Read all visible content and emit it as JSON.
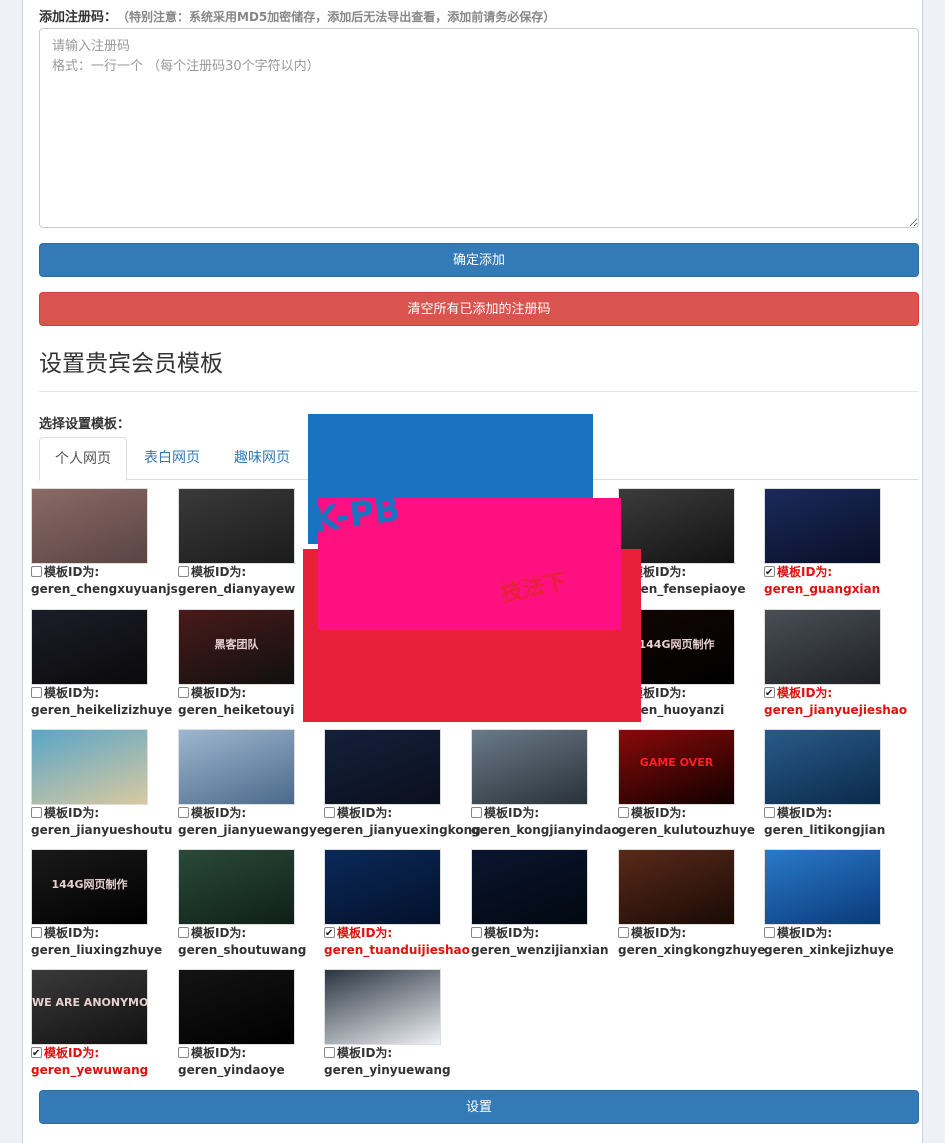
{
  "register": {
    "label": "添加注册码：",
    "note": "（特别注意：系统采用MD5加密储存，添加后无法导出查看，添加前请务必保存）",
    "placeholder": "请输入注册码\n格式：一行一个 （每个注册码30个字符以内）",
    "confirm_label": "确定添加",
    "clear_label": "清空所有已添加的注册码"
  },
  "vip": {
    "title": "设置贵宾会员模板",
    "choose_label": "选择设置模板：",
    "tabs": [
      "个人网页",
      "表白网页",
      "趣味网页"
    ],
    "id_prefix": "模板ID为:",
    "set_label": "设置"
  },
  "templates": [
    {
      "id": "geren_chengxuyuanjs",
      "checked": false,
      "theme": [
        "#8a6a66",
        "#5a4444"
      ]
    },
    {
      "id": "geren_dianyayew",
      "checked": false,
      "theme": [
        "#3a3a3a",
        "#1b1b1b"
      ]
    },
    {
      "id": "",
      "checked": false,
      "theme": [
        "#1b1b1b",
        "#1b1b1b"
      ]
    },
    {
      "id": "",
      "checked": false,
      "theme": [
        "#1b1b1b",
        "#1b1b1b"
      ]
    },
    {
      "id": "geren_fensepiaoye",
      "checked": false,
      "theme": [
        "#3c3c3c",
        "#121212"
      ]
    },
    {
      "id": "geren_guangxian",
      "checked": true,
      "theme": [
        "#1a2a5a",
        "#0a0f28"
      ]
    },
    {
      "id": "geren_heikelizizhuye",
      "checked": false,
      "theme": [
        "#1d1d2a",
        "#0a0a0a"
      ]
    },
    {
      "id": "geren_heiketouyi",
      "checked": false,
      "theme": [
        "#4a1a1a",
        "#101010"
      ]
    },
    {
      "id": "",
      "checked": false,
      "theme": [
        "#1b1b1b",
        "#1b1b1b"
      ]
    },
    {
      "id": "",
      "checked": false,
      "theme": [
        "#1b1b1b",
        "#1b1b1b"
      ]
    },
    {
      "id": "geren_huoyanzi",
      "checked": false,
      "theme": [
        "#120606",
        "#000000"
      ]
    },
    {
      "id": "geren_jianyuejieshao",
      "checked": true,
      "theme": [
        "#4a4f55",
        "#1e2226"
      ]
    },
    {
      "id": "geren_jianyueshoutu",
      "checked": false,
      "theme": [
        "#5aa5c8",
        "#d8c9a0"
      ]
    },
    {
      "id": "geren_jianyuewangye",
      "checked": false,
      "theme": [
        "#9fb6cf",
        "#4a6a8a"
      ]
    },
    {
      "id": "geren_jianyuexingkong",
      "checked": false,
      "theme": [
        "#14203a",
        "#0a0f1e"
      ]
    },
    {
      "id": "geren_kongjianyindao",
      "checked": false,
      "theme": [
        "#6a7a88",
        "#2a323a"
      ]
    },
    {
      "id": "geren_kulutouzhuye",
      "checked": false,
      "theme": [
        "#8a0a0a",
        "#100000"
      ]
    },
    {
      "id": "geren_litikongjian",
      "checked": false,
      "theme": [
        "#2a5a8a",
        "#0a2a4a"
      ]
    },
    {
      "id": "geren_liuxingzhuye",
      "checked": false,
      "theme": [
        "#1a1a1a",
        "#000000"
      ]
    },
    {
      "id": "geren_shoutuwang",
      "checked": false,
      "theme": [
        "#2a4a3a",
        "#0f1f18"
      ]
    },
    {
      "id": "geren_tuanduijieshao",
      "checked": true,
      "theme": [
        "#0a2a5a",
        "#04102a"
      ]
    },
    {
      "id": "geren_wenzijianxian",
      "checked": false,
      "theme": [
        "#0a1530",
        "#020810"
      ]
    },
    {
      "id": "geren_xingkongzhuye",
      "checked": false,
      "theme": [
        "#5a2a1a",
        "#1a0a05"
      ]
    },
    {
      "id": "geren_xinkejizhuye",
      "checked": false,
      "theme": [
        "#2a7ac8",
        "#0a3a7a"
      ]
    },
    {
      "id": "geren_yewuwang",
      "checked": true,
      "theme": [
        "#3a3a3a",
        "#111111"
      ]
    },
    {
      "id": "geren_yindaoye",
      "checked": false,
      "theme": [
        "#141414",
        "#000000"
      ]
    },
    {
      "id": "geren_yinyuewang",
      "checked": false,
      "theme": [
        "#2a3440",
        "#eef1f4"
      ]
    }
  ],
  "thumb_texts": {
    "t0": "",
    "t7": "黑客团队",
    "t10": "144G网页制作",
    "t16": "GAME OVER",
    "t18": "144G网页制作",
    "t24": "WE ARE ANONYMOUS"
  },
  "overlay": {
    "blue": "#1a73c0",
    "pink": "#ff1080",
    "red": "#e8203a",
    "text_a": "K-PB",
    "text_b": "技法下"
  }
}
